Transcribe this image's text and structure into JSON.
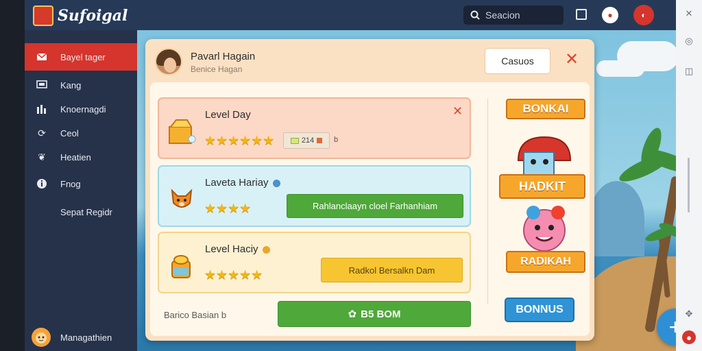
{
  "app": {
    "logo_text": "Sufoigal",
    "search_placeholder": "Seacion"
  },
  "sidebar": {
    "items": [
      {
        "label": "Bayel tager",
        "icon": "mail-icon",
        "active": true
      },
      {
        "label": "Kang",
        "icon": "monitor-icon",
        "active": false
      },
      {
        "label": "Knoernagdi",
        "icon": "chart-icon",
        "active": false
      },
      {
        "label": "Ceol",
        "icon": "refresh-icon",
        "active": false
      },
      {
        "label": "Heatien",
        "icon": "leaf-icon",
        "active": false
      },
      {
        "label": "Fnog",
        "icon": "info-icon",
        "active": false
      },
      {
        "label": "Sepat Regidr",
        "icon": "",
        "active": false
      }
    ],
    "profile_label": "Managathien"
  },
  "dialog": {
    "user_name": "Pavarl Hagain",
    "user_sub": "Benice Hagan",
    "top_button": "Casuos",
    "levels": [
      {
        "title": "Level Day",
        "stars": 6,
        "chip": "214",
        "chip_extra": "b",
        "icon": "treasure-box-icon"
      },
      {
        "title": "Laveta Hariay",
        "stars": 4,
        "button": "Rahlanclaayn cloel Farhanhiam",
        "icon": "fox-icon"
      },
      {
        "title": "Level Haciy",
        "stars": 5,
        "button": "Radkol Bersalkn Dam",
        "icon": "honey-pot-icon"
      }
    ],
    "footer_text": "Barico Basian b",
    "main_button": "B5 BOM",
    "bonus": {
      "ribbon_top": "BONKAI",
      "ribbon_mid": "HADKIT",
      "ribbon_bottom": "RADIKAH",
      "button": "BONNUS"
    }
  },
  "colors": {
    "accent_red": "#d5352c",
    "green": "#4fa83a",
    "yellow": "#f6c531",
    "blue": "#2f93d5"
  }
}
